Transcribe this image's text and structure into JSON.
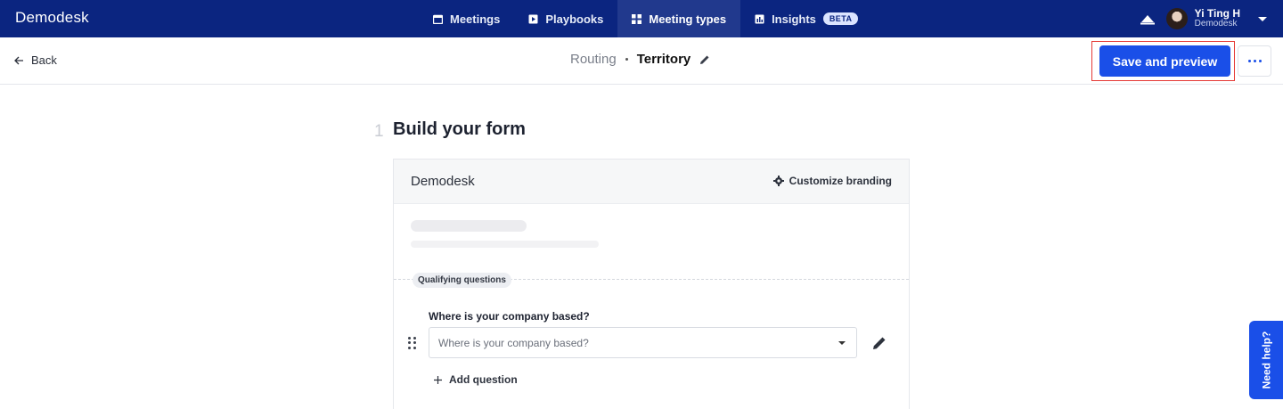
{
  "nav": {
    "logo": "Demodesk",
    "tabs": [
      {
        "label": "Meetings",
        "icon": "calendar-icon",
        "active": false
      },
      {
        "label": "Playbooks",
        "icon": "playbook-icon",
        "active": false
      },
      {
        "label": "Meeting types",
        "icon": "grid-icon",
        "active": true
      },
      {
        "label": "Insights",
        "icon": "chart-icon",
        "active": false,
        "badge": "BETA"
      }
    ],
    "user": {
      "name": "Yi Ting H",
      "org": "Demodesk"
    }
  },
  "subheader": {
    "back_label": "Back",
    "breadcrumb_parent": "Routing",
    "breadcrumb_current": "Territory",
    "save_label": "Save and preview"
  },
  "main": {
    "step_number": "1",
    "step_title": "Build your form",
    "form": {
      "logo": "Demodesk",
      "customize_label": "Customize branding",
      "section_label": "Qualifying questions",
      "question_label": "Where is your company based?",
      "question_placeholder": "Where is your company based?",
      "add_question_label": "Add question"
    }
  },
  "help_label": "Need help?",
  "colors": {
    "nav_bg": "#0b2580",
    "primary": "#1a4fe8",
    "highlight": "#e53935"
  }
}
